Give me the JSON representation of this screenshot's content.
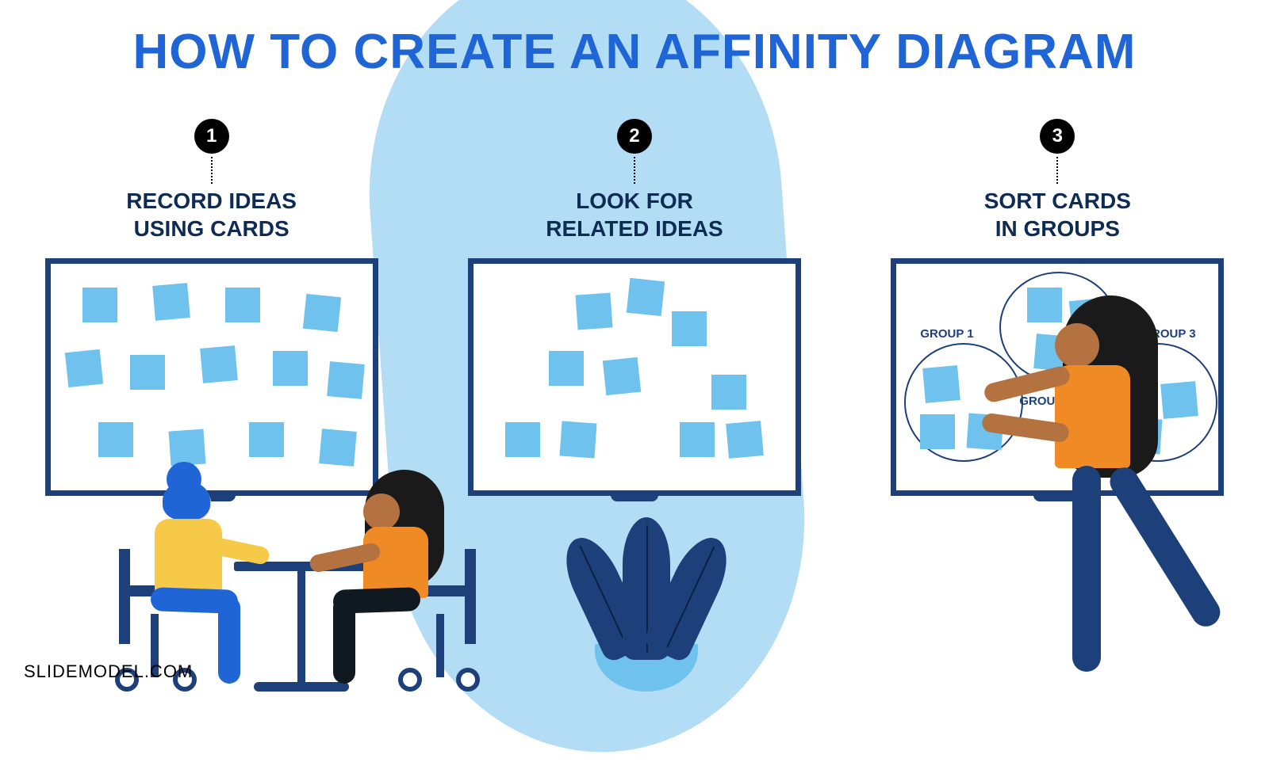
{
  "title": "HOW TO CREATE AN AFFINITY DIAGRAM",
  "footer": "SLIDEMODEL.COM",
  "steps": [
    {
      "number": "1",
      "heading": "RECORD IDEAS\nUSING CARDS"
    },
    {
      "number": "2",
      "heading": "LOOK FOR\nRELATED IDEAS"
    },
    {
      "number": "3",
      "heading": "SORT CARDS\nIN GROUPS"
    }
  ],
  "groups": {
    "g1": "GROUP 1",
    "g2": "GROUP 2",
    "g3": "GROUP 3"
  }
}
